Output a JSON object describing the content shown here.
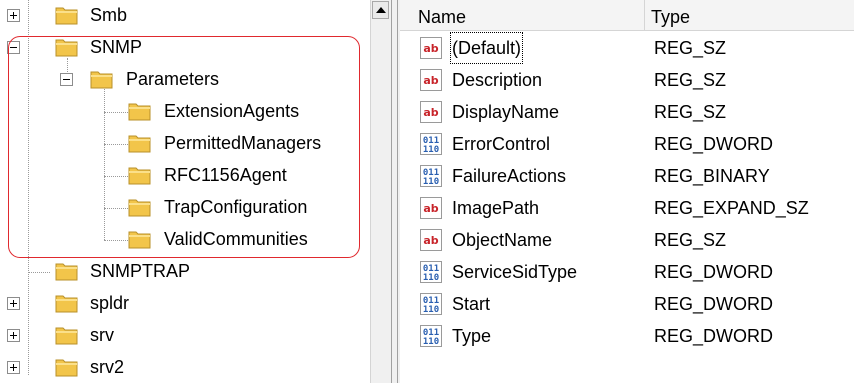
{
  "tree": {
    "items": [
      {
        "label": "Smb",
        "expander": "plus"
      },
      {
        "label": "SNMP",
        "expander": "minus"
      },
      {
        "label": "Parameters",
        "expander": "minus"
      },
      {
        "label": "ExtensionAgents"
      },
      {
        "label": "PermittedManagers"
      },
      {
        "label": "RFC1156Agent"
      },
      {
        "label": "TrapConfiguration"
      },
      {
        "label": "ValidCommunities"
      },
      {
        "label": "SNMPTRAP"
      },
      {
        "label": "spldr",
        "expander": "plus"
      },
      {
        "label": "srv",
        "expander": "plus"
      },
      {
        "label": "srv2",
        "expander": "plus"
      }
    ],
    "highlight_color": "#e0292e"
  },
  "list": {
    "columns": {
      "name": "Name",
      "type": "Type"
    },
    "rows": [
      {
        "icon": "string-value-icon",
        "name": "(Default)",
        "type": "REG_SZ",
        "focused": true
      },
      {
        "icon": "string-value-icon",
        "name": "Description",
        "type": "REG_SZ"
      },
      {
        "icon": "string-value-icon",
        "name": "DisplayName",
        "type": "REG_SZ"
      },
      {
        "icon": "binary-value-icon",
        "name": "ErrorControl",
        "type": "REG_DWORD"
      },
      {
        "icon": "binary-value-icon",
        "name": "FailureActions",
        "type": "REG_BINARY"
      },
      {
        "icon": "string-value-icon",
        "name": "ImagePath",
        "type": "REG_EXPAND_SZ"
      },
      {
        "icon": "string-value-icon",
        "name": "ObjectName",
        "type": "REG_SZ"
      },
      {
        "icon": "binary-value-icon",
        "name": "ServiceSidType",
        "type": "REG_DWORD"
      },
      {
        "icon": "binary-value-icon",
        "name": "Start",
        "type": "REG_DWORD"
      },
      {
        "icon": "binary-value-icon",
        "name": "Type",
        "type": "REG_DWORD"
      }
    ]
  },
  "colors": {
    "folder": "#f2c54a",
    "string_icon": "#c8242a",
    "binary_icon": "#2a5fb0"
  }
}
